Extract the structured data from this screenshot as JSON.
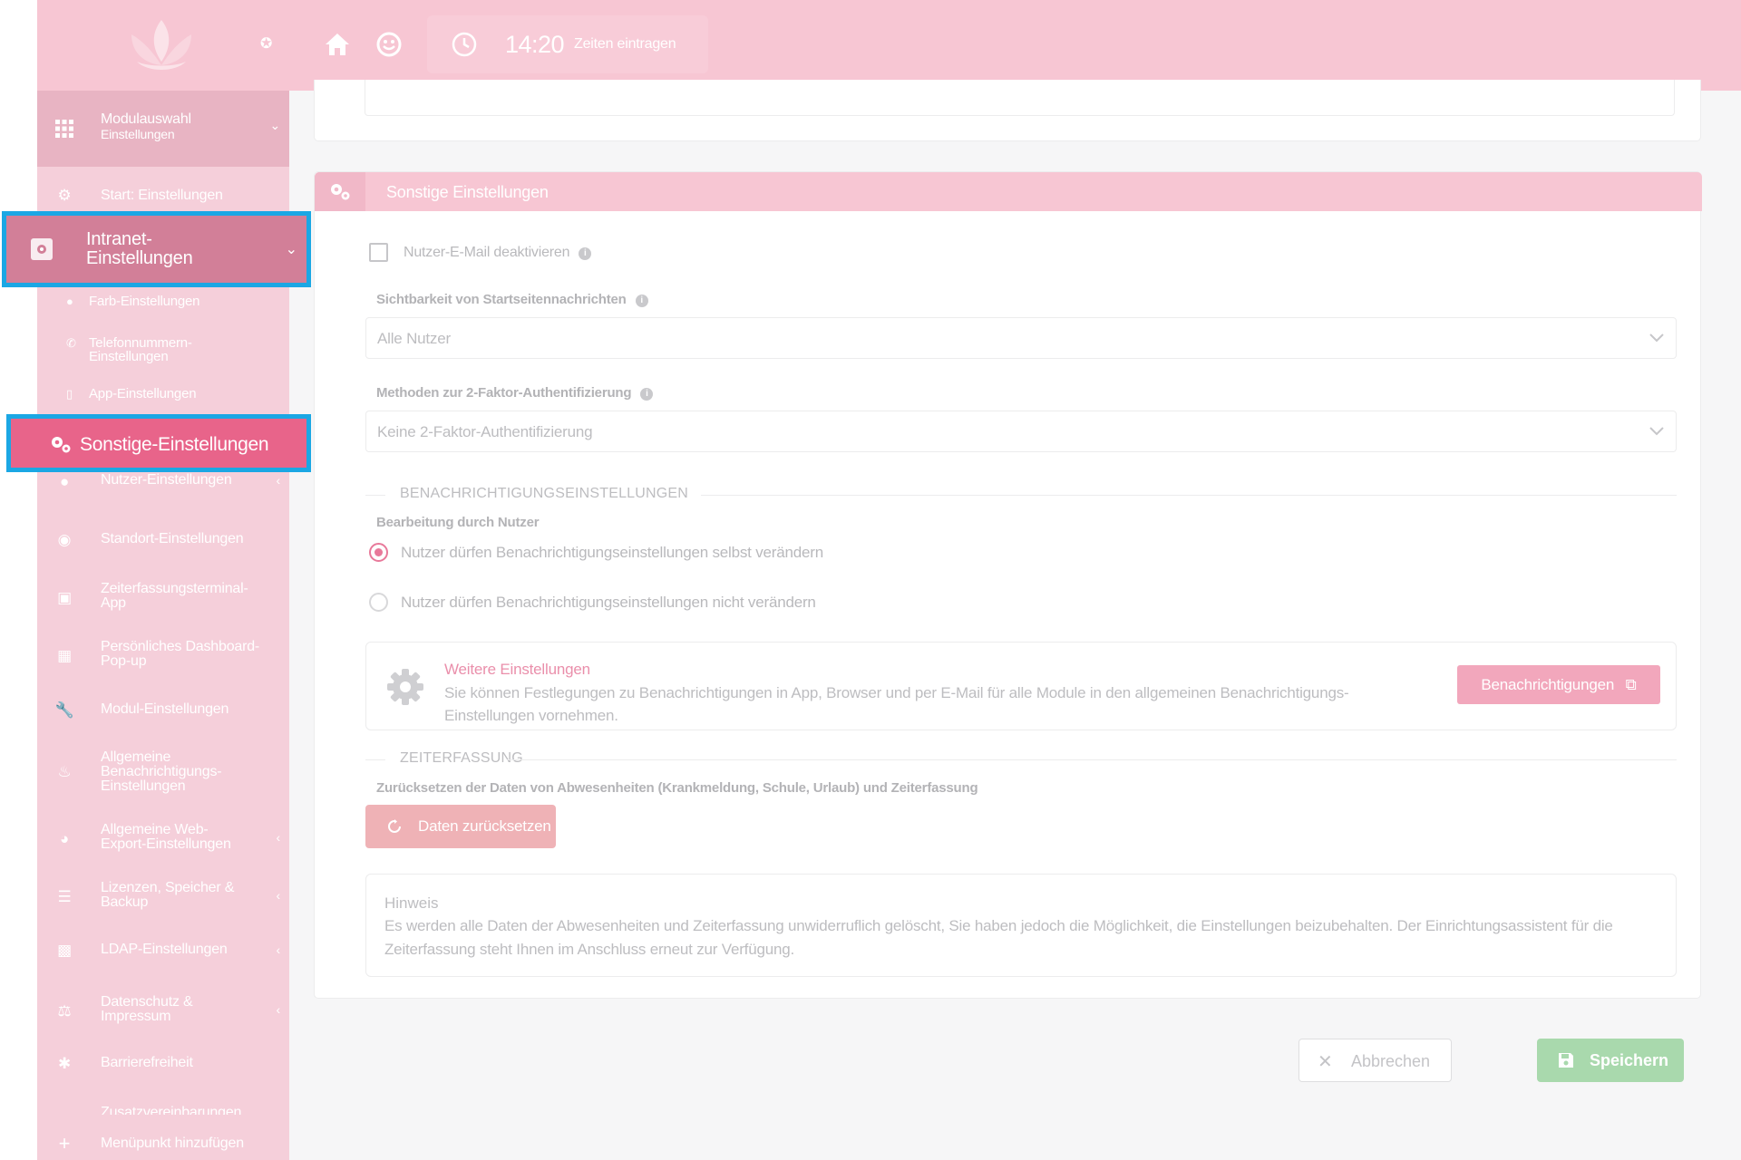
{
  "header": {
    "time": "14:20",
    "time_entry_label": "Zeiten eintragen"
  },
  "sidebar": {
    "modulauswahl": {
      "title": "Modulauswahl",
      "subtitle": "Einstellungen"
    },
    "start": "Start: Einstellungen",
    "intranet": {
      "line1": "Intranet-",
      "line2": "Einstellungen"
    },
    "sub_items": [
      {
        "line1": "Farb-Einstellungen",
        "line2": ""
      },
      {
        "line1": "Telefonnummern-",
        "line2": "Einstellungen"
      },
      {
        "line1": "App-Einstellungen",
        "line2": ""
      }
    ],
    "active": "Sonstige-Einstellungen",
    "items": [
      {
        "line1": "Nutzer-Einstellungen",
        "line2": "",
        "line3": ""
      },
      {
        "line1": "Standort-Einstellungen",
        "line2": "",
        "line3": ""
      },
      {
        "line1": "Zeiterfassungsterminal-",
        "line2": "App",
        "line3": ""
      },
      {
        "line1": "Persönliches Dashboard-",
        "line2": "Pop-up",
        "line3": ""
      },
      {
        "line1": "Modul-Einstellungen",
        "line2": "",
        "line3": ""
      },
      {
        "line1": "Allgemeine",
        "line2": "Benachrichtigungs-",
        "line3": "Einstellungen"
      },
      {
        "line1": "Allgemeine Web-",
        "line2": "Export-Einstellungen",
        "line3": ""
      },
      {
        "line1": "Lizenzen, Speicher &",
        "line2": "Backup",
        "line3": ""
      },
      {
        "line1": "LDAP-Einstellungen",
        "line2": "",
        "line3": ""
      },
      {
        "line1": "Datenschutz &",
        "line2": "Impressum",
        "line3": ""
      },
      {
        "line1": "Barrierefreiheit",
        "line2": "",
        "line3": ""
      }
    ],
    "cut_item": "Zusatzvereinbarungen",
    "add_item": "Menüpunkt hinzufügen"
  },
  "card": {
    "title": "Sonstige Einstellungen",
    "email_checkbox_label": "Nutzer-E-Mail deaktivieren",
    "visibility_label": "Sichtbarkeit von Startseitennachrichten",
    "visibility_value": "Alle Nutzer",
    "twofa_label": "Methoden zur 2-Faktor-Authentifizierung",
    "twofa_value": "Keine 2-Faktor-Authentifizierung",
    "notif_section": "BENACHRICHTIGUNGSEINSTELLUNGEN",
    "edit_label": "Bearbeitung durch Nutzer",
    "radio_allow": "Nutzer dürfen Benachrichtigungseinstellungen selbst verändern",
    "radio_deny": "Nutzer dürfen Benachrichtigungseinstellungen nicht verändern",
    "more_title": "Weitere Einstellungen",
    "more_desc": "Sie können Festlegungen zu Benachrichtigungen in App, Browser und per E-Mail für alle Module in den allgemeinen Benachrichtigungs-Einstellungen vornehmen.",
    "notif_button": "Benachrichtigungen",
    "time_section": "ZEITERFASSUNG",
    "reset_label": "Zurücksetzen der Daten von Abwesenheiten (Krankmeldung, Schule, Urlaub) und Zeiterfassung",
    "reset_button": "Daten zurücksetzen",
    "hint_title": "Hinweis",
    "hint_text": "Es werden alle Daten der Abwesenheiten und Zeiterfassung unwiderruflich gelöscht, Sie haben jedoch die Möglichkeit, die Einstellungen beizubehalten. Der Einrichtungsassistent für die Zeiterfassung steht Ihnen im Anschluss erneut zur Verfügung."
  },
  "footer": {
    "cancel": "Abbrechen",
    "save": "Speichern"
  },
  "colors": {
    "sidebar": "#f5cfda",
    "header": "#f7c6d3",
    "active_item": "#e8648a",
    "highlight_border": "#1ba7e4",
    "save": "#a9d9ad"
  }
}
